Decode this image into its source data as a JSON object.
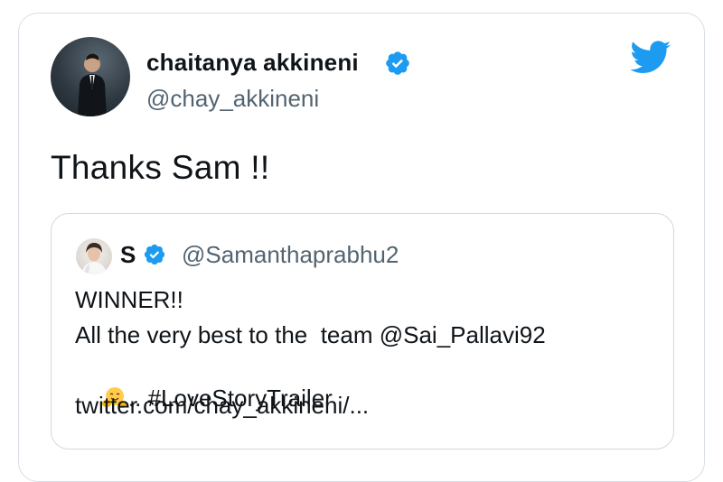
{
  "tweet": {
    "author_name": "chaitanya akkineni",
    "author_handle": "@chay_akkineni",
    "text": "Thanks Sam !!"
  },
  "quoted_tweet": {
    "author_name": "S",
    "author_handle": "@Samanthaprabhu2",
    "line1": "WINNER!!",
    "line2": "All the very best to the  team @Sai_Pallavi92",
    "line3": ".. #LoveStoryTrailer",
    "line4": "twitter.com/chay_akkineni/..."
  },
  "colors": {
    "twitter_blue": "#1d9bf0",
    "text_primary": "#0f1419",
    "text_secondary": "#536471",
    "border": "#cfd9de"
  },
  "icons": {
    "brand": "twitter-bird-icon",
    "verified": "verified-badge-icon",
    "emoji": "hugging-face-emoji"
  }
}
